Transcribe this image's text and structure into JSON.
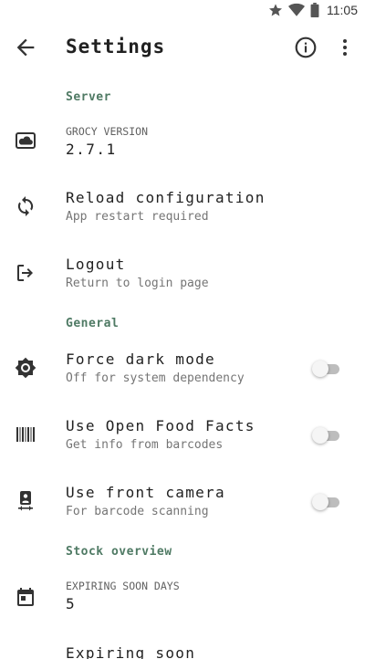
{
  "status_bar": {
    "time": "11:05",
    "icons": [
      "star-icon",
      "wifi-icon",
      "battery-icon"
    ]
  },
  "app_bar": {
    "title": "Settings",
    "icons": [
      "back-arrow-icon",
      "info-icon",
      "more-vert-icon"
    ]
  },
  "sections": {
    "server": {
      "header": "Server",
      "grocy_version": {
        "caption": "GROCY VERSION",
        "value": "2.7.1"
      },
      "reload": {
        "title": "Reload configuration",
        "subtitle": "App restart required"
      },
      "logout": {
        "title": "Logout",
        "subtitle": "Return to login page"
      }
    },
    "general": {
      "header": "General",
      "dark_mode": {
        "title": "Force dark mode",
        "subtitle": "Off for system dependency",
        "enabled": false
      },
      "open_food_facts": {
        "title": "Use Open Food Facts",
        "subtitle": "Get info from barcodes",
        "enabled": false
      },
      "front_camera": {
        "title": "Use front camera",
        "subtitle": "For barcode scanning",
        "enabled": false
      }
    },
    "stock_overview": {
      "header": "Stock overview",
      "expiring_soon": {
        "caption": "EXPIRING SOON DAYS",
        "value": "5"
      },
      "partial_next": "Expiring soon"
    }
  },
  "colors": {
    "accent": "#4f7a64",
    "text_primary": "#212121",
    "text_secondary": "#757575",
    "switch_track": "#bdbdbd"
  }
}
